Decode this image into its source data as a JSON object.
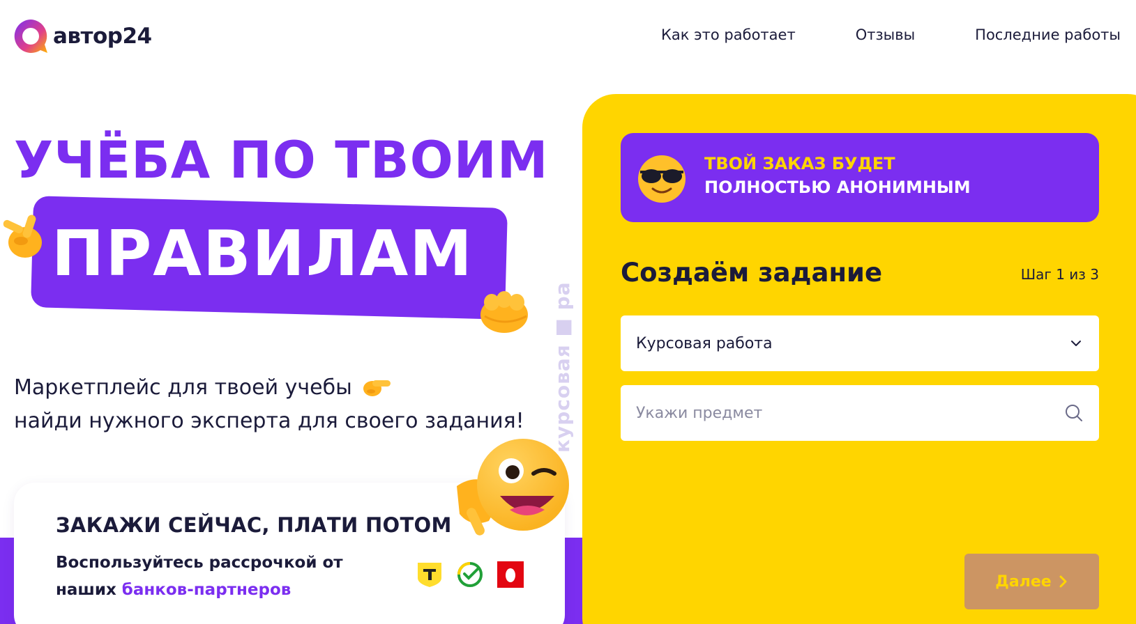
{
  "header": {
    "logo_text": "автор24",
    "nav": [
      "Как это работает",
      "Отзывы",
      "Последние работы"
    ]
  },
  "hero": {
    "line1": "УЧЁБА ПО ТВОИМ",
    "line2": "ПРАВИЛАМ",
    "sub_line1": "Маркетплейс для твоей учебы",
    "sub_line2": "найди нужного эксперта для своего задания!",
    "vertical_text": "курсовая ■ ра"
  },
  "promo": {
    "title": "ЗАКАЖИ СЕЙЧАС, ПЛАТИ ПОТОМ",
    "text_line1": "Воспользуйтесь рассрочкой от",
    "text_prefix": "наших ",
    "link": "банков-партнеров"
  },
  "form": {
    "anon_line1": "ТВОЙ ЗАКАЗ БУДЕТ",
    "anon_line2": "ПОЛНОСТЬЮ АНОНИМНЫМ",
    "title": "Создаём задание",
    "step": "Шаг 1 из 3",
    "work_type": "Курсовая работа",
    "subject_placeholder": "Укажи предмет",
    "next_label": "Далее"
  },
  "colors": {
    "accent": "#7b2ef0",
    "yellow": "#ffd500",
    "dark": "#1b1b3a",
    "button": "#cc9563"
  }
}
